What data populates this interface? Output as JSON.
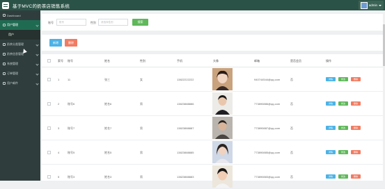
{
  "app": {
    "title": "基于MVC的奶茶店销售系统",
    "user": "admin"
  },
  "sidebar": {
    "items": [
      {
        "label": "Dashboard"
      },
      {
        "label": "用户管理"
      },
      {
        "label": "用户"
      },
      {
        "label": "奶茶分类管理"
      },
      {
        "label": "奶茶信息管理"
      },
      {
        "label": "系统管理"
      },
      {
        "label": "订单管理"
      },
      {
        "label": "用户邮件"
      }
    ]
  },
  "search": {
    "account_label": "账号",
    "account_placeholder": "账号",
    "gender_label": "性别",
    "gender_placeholder": "请选择性别",
    "button": "搜索"
  },
  "actions": {
    "add": "新增",
    "delete": "删除"
  },
  "table": {
    "headers": [
      "索号",
      "账号",
      "姓名",
      "性别",
      "手机",
      "头像",
      "邮箱",
      "是否会员",
      "操作"
    ],
    "op_labels": {
      "detail": "详情",
      "edit": "修改",
      "remove": "删除"
    },
    "rows": [
      {
        "idx": "1",
        "account": "11",
        "name": "张三",
        "gender": "女",
        "phone": "13822222222",
        "email": "940744544@qq.com",
        "member": "否"
      },
      {
        "idx": "2",
        "account": "账号6",
        "name": "姓名6",
        "gender": "男",
        "phone": "13823888886",
        "email": "773890886@qq.com",
        "member": "否"
      },
      {
        "idx": "3",
        "account": "账号7",
        "name": "姓名7",
        "gender": "男",
        "phone": "13823888887",
        "email": "773890887@qq.com",
        "member": "否"
      },
      {
        "idx": "4",
        "account": "账号5",
        "name": "姓名5",
        "gender": "男",
        "phone": "13823888885",
        "email": "773890885@qq.com",
        "member": "否"
      },
      {
        "idx": "5",
        "account": "账号3",
        "name": "姓名3",
        "gender": "男",
        "phone": "13823888883",
        "email": "773890883@qq.com",
        "member": "否"
      }
    ]
  },
  "colors": {
    "topbar": "#2b5246",
    "sidebar": "#2f3e3d",
    "active": "#1f6b52",
    "blue": "#4db3e6",
    "green": "#5fb85a",
    "red": "#f07c63"
  }
}
